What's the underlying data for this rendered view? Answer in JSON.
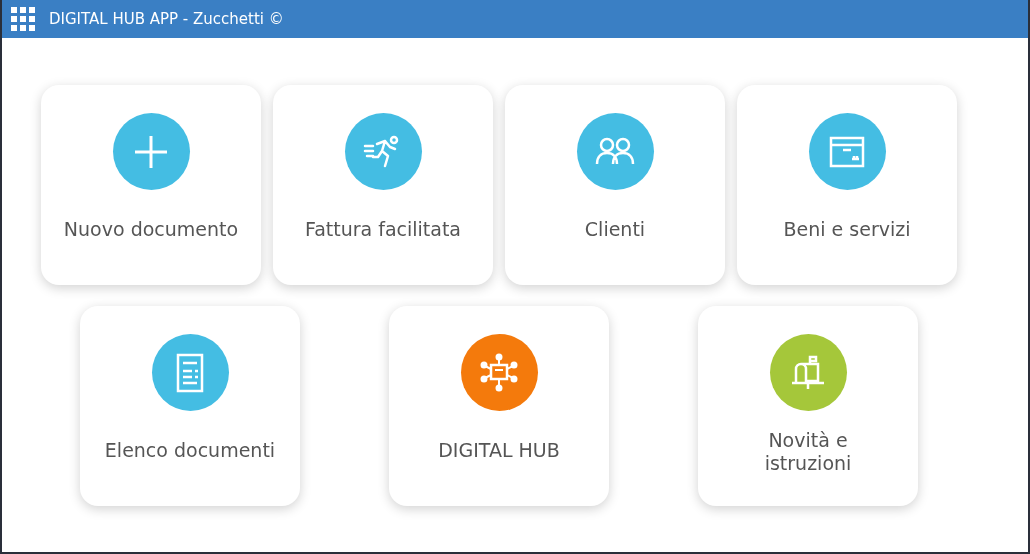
{
  "window": {
    "title": "DIGITAL HUB APP - Zucchetti ©"
  },
  "tiles": [
    {
      "label": "Nuovo documento",
      "color": "#44bde3"
    },
    {
      "label": "Fattura facilitata",
      "color": "#44bde3"
    },
    {
      "label": "Clienti",
      "color": "#44bde3"
    },
    {
      "label": "Beni e servizi",
      "color": "#44bde3"
    },
    {
      "label": "Elenco documenti",
      "color": "#44bde3"
    },
    {
      "label": "DIGITAL HUB",
      "color": "#f47a0c"
    },
    {
      "label": "Novità e istruzioni",
      "color": "#a5c73a"
    }
  ]
}
